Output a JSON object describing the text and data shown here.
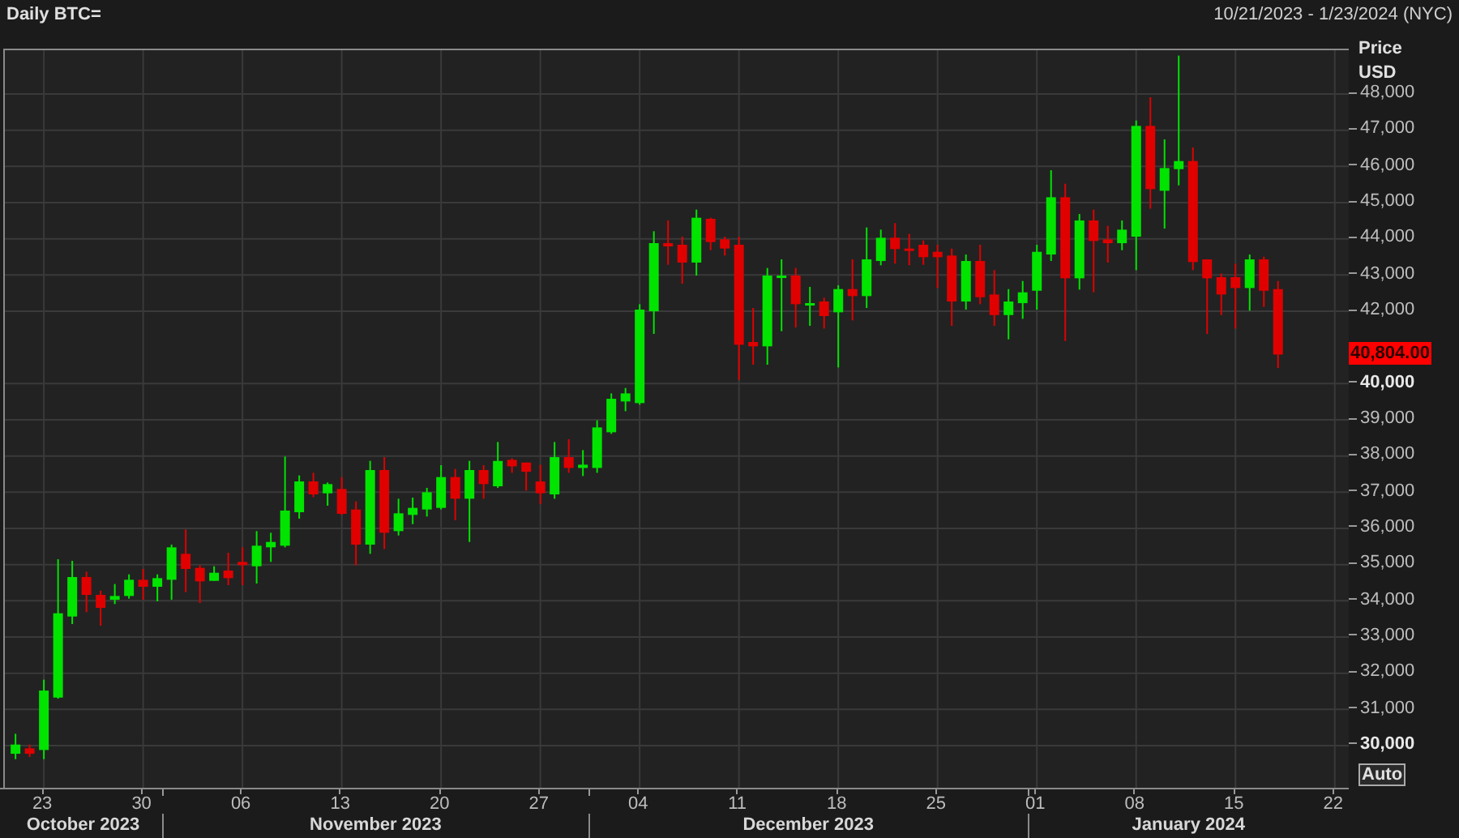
{
  "header": {
    "date_range": "10/21/2023 - 1/23/2024 (NYC)"
  },
  "price_axis": {
    "title": "Price",
    "unit": "USD",
    "last_price": "40,804.00",
    "auto_button": "Auto"
  },
  "x_axis": {
    "months": [
      {
        "label": "October 2023"
      },
      {
        "label": "November 2023"
      },
      {
        "label": "December 2023"
      },
      {
        "label": "January 2024"
      }
    ]
  },
  "chart": {
    "chart_data": {
      "type": "candlestick",
      "title": "Daily BTC=",
      "grid": true,
      "x": [
        "2023-10-21",
        "2023-10-22",
        "2023-10-23",
        "2023-10-24",
        "2023-10-25",
        "2023-10-26",
        "2023-10-27",
        "2023-10-28",
        "2023-10-29",
        "2023-10-30",
        "2023-10-31",
        "2023-11-01",
        "2023-11-02",
        "2023-11-03",
        "2023-11-04",
        "2023-11-05",
        "2023-11-06",
        "2023-11-07",
        "2023-11-08",
        "2023-11-09",
        "2023-11-10",
        "2023-11-11",
        "2023-11-12",
        "2023-11-13",
        "2023-11-14",
        "2023-11-15",
        "2023-11-16",
        "2023-11-17",
        "2023-11-18",
        "2023-11-19",
        "2023-11-20",
        "2023-11-21",
        "2023-11-22",
        "2023-11-23",
        "2023-11-24",
        "2023-11-25",
        "2023-11-26",
        "2023-11-27",
        "2023-11-28",
        "2023-11-29",
        "2023-11-30",
        "2023-12-01",
        "2023-12-02",
        "2023-12-03",
        "2023-12-04",
        "2023-12-05",
        "2023-12-06",
        "2023-12-07",
        "2023-12-08",
        "2023-12-09",
        "2023-12-10",
        "2023-12-11",
        "2023-12-12",
        "2023-12-13",
        "2023-12-14",
        "2023-12-15",
        "2023-12-16",
        "2023-12-17",
        "2023-12-18",
        "2023-12-19",
        "2023-12-20",
        "2023-12-21",
        "2023-12-22",
        "2023-12-23",
        "2023-12-24",
        "2023-12-25",
        "2023-12-26",
        "2023-12-27",
        "2023-12-28",
        "2023-12-29",
        "2023-12-30",
        "2023-12-31",
        "2024-01-01",
        "2024-01-02",
        "2024-01-03",
        "2024-01-04",
        "2024-01-05",
        "2024-01-06",
        "2024-01-07",
        "2024-01-08",
        "2024-01-09",
        "2024-01-10",
        "2024-01-11",
        "2024-01-12",
        "2024-01-13",
        "2024-01-14",
        "2024-01-15",
        "2024-01-16",
        "2024-01-17",
        "2024-01-18"
      ],
      "ohlc": [
        [
          29774,
          30326,
          29625,
          30028
        ],
        [
          29923,
          30028,
          29684,
          29774
        ],
        [
          29878,
          31820,
          29625,
          31520
        ],
        [
          31326,
          35148,
          31296,
          33655
        ],
        [
          33566,
          35104,
          33357,
          34656
        ],
        [
          34656,
          34805,
          33685,
          34163
        ],
        [
          34163,
          34282,
          33312,
          33805
        ],
        [
          34029,
          34462,
          33909,
          34133
        ],
        [
          34133,
          34730,
          34059,
          34581
        ],
        [
          34581,
          34880,
          34029,
          34387
        ],
        [
          34387,
          34730,
          33984,
          34626
        ],
        [
          34581,
          35552,
          34029,
          35477
        ],
        [
          35298,
          35970,
          34238,
          34880
        ],
        [
          34910,
          34984,
          33939,
          34536
        ],
        [
          34551,
          34954,
          34551,
          34775
        ],
        [
          34835,
          35328,
          34432,
          34626
        ],
        [
          35074,
          35477,
          34432,
          34984
        ],
        [
          34954,
          35925,
          34477,
          35522
        ],
        [
          35477,
          35880,
          35074,
          35626
        ],
        [
          35522,
          37985,
          35477,
          36492
        ],
        [
          36447,
          37463,
          36268,
          37298
        ],
        [
          37298,
          37537,
          36865,
          36940
        ],
        [
          36970,
          37269,
          36626,
          37224
        ],
        [
          37089,
          37418,
          36373,
          36402
        ],
        [
          36522,
          36746,
          34984,
          35552
        ],
        [
          35552,
          37866,
          35298,
          37612
        ],
        [
          37612,
          37970,
          35432,
          35880
        ],
        [
          35925,
          36820,
          35805,
          36417
        ],
        [
          36373,
          36850,
          36119,
          36567
        ],
        [
          36522,
          37119,
          36328,
          36999
        ],
        [
          36567,
          37746,
          36522,
          37418
        ],
        [
          37418,
          37642,
          36223,
          36820
        ],
        [
          36820,
          37866,
          35626,
          37612
        ],
        [
          37612,
          37746,
          36820,
          37224
        ],
        [
          37163,
          38387,
          37118,
          37864
        ],
        [
          37894,
          37939,
          37536,
          37715
        ],
        [
          37819,
          37819,
          37043,
          37566
        ],
        [
          37297,
          37760,
          36670,
          36969
        ],
        [
          36939,
          38387,
          36819,
          37969
        ],
        [
          37969,
          38462,
          37536,
          37670
        ],
        [
          37670,
          38163,
          37446,
          37760
        ],
        [
          37670,
          38984,
          37536,
          38790
        ],
        [
          38656,
          39730,
          38611,
          39581
        ],
        [
          39507,
          39880,
          39238,
          39730
        ],
        [
          39462,
          42194,
          39417,
          42045
        ],
        [
          41999,
          44210,
          41373,
          43881
        ],
        [
          43881,
          44508,
          43284,
          43791
        ],
        [
          43836,
          44060,
          42761,
          43344
        ],
        [
          43344,
          44807,
          42985,
          44583
        ],
        [
          44553,
          44583,
          43687,
          43911
        ],
        [
          43986,
          44060,
          43538,
          43732
        ],
        [
          43836,
          44060,
          40104,
          41074
        ],
        [
          41149,
          42089,
          40522,
          41030
        ],
        [
          41030,
          43194,
          40522,
          42985
        ],
        [
          42940,
          43433,
          41448,
          42985
        ],
        [
          42985,
          43194,
          41552,
          42194
        ],
        [
          42164,
          42672,
          41597,
          42224
        ],
        [
          42269,
          42373,
          41522,
          41866
        ],
        [
          41970,
          42717,
          40447,
          42612
        ],
        [
          42612,
          43433,
          41746,
          42418
        ],
        [
          42418,
          44314,
          42089,
          43433
        ],
        [
          43388,
          44254,
          43269,
          44030
        ],
        [
          44030,
          44433,
          43314,
          43717
        ],
        [
          43732,
          44135,
          43269,
          43687
        ],
        [
          43836,
          43956,
          43284,
          43493
        ],
        [
          43642,
          43836,
          42642,
          43493
        ],
        [
          43537,
          43731,
          41596,
          42268
        ],
        [
          42268,
          43567,
          42044,
          43388
        ],
        [
          43388,
          43835,
          42193,
          42387
        ],
        [
          42462,
          43134,
          41596,
          41894
        ],
        [
          41894,
          42611,
          41223,
          42268
        ],
        [
          42223,
          42835,
          41790,
          42522
        ],
        [
          42566,
          43835,
          42044,
          43641
        ],
        [
          43567,
          45896,
          43388,
          45149
        ],
        [
          45149,
          45522,
          41178,
          42910
        ],
        [
          42910,
          44686,
          42596,
          44507
        ],
        [
          44507,
          44806,
          42522,
          43940
        ],
        [
          43985,
          44358,
          43343,
          43880
        ],
        [
          43880,
          44507,
          43686,
          44253
        ],
        [
          44059,
          47269,
          43134,
          47120
        ],
        [
          47120,
          47911,
          44836,
          45373
        ],
        [
          45328,
          46747,
          44283,
          45955
        ],
        [
          45925,
          49061,
          45478,
          46149
        ],
        [
          46149,
          46523,
          43134,
          43358
        ],
        [
          43432,
          43432,
          41372,
          42910
        ],
        [
          42940,
          43044,
          41894,
          42462
        ],
        [
          42940,
          43313,
          41521,
          42641
        ],
        [
          42641,
          43567,
          42014,
          43432
        ],
        [
          43432,
          43507,
          42119,
          42566
        ],
        [
          42611,
          42835,
          40431,
          40804
        ]
      ],
      "xlim": [
        "2023-10-20T06:00:00",
        "2024-01-23T02:24:00"
      ],
      "ylim": [
        28790,
        49210
      ],
      "xticks": [
        {
          "value": "2023-10-23",
          "label": "23"
        },
        {
          "value": "2023-10-30",
          "label": "30"
        },
        {
          "value": "2023-11-06",
          "label": "06"
        },
        {
          "value": "2023-11-13",
          "label": "13"
        },
        {
          "value": "2023-11-20",
          "label": "20"
        },
        {
          "value": "2023-11-27",
          "label": "27"
        },
        {
          "value": "2023-12-04",
          "label": "04"
        },
        {
          "value": "2023-12-11",
          "label": "11"
        },
        {
          "value": "2023-12-18",
          "label": "18"
        },
        {
          "value": "2023-12-25",
          "label": "25"
        },
        {
          "value": "2024-01-01",
          "label": "01"
        },
        {
          "value": "2024-01-08",
          "label": "08"
        },
        {
          "value": "2024-01-15",
          "label": "15"
        },
        {
          "value": "2024-01-22",
          "label": "22"
        }
      ],
      "yticks": [
        {
          "value": 30000,
          "label": "30,000"
        },
        {
          "value": 31000,
          "label": "31,000"
        },
        {
          "value": 32000,
          "label": "32,000"
        },
        {
          "value": 33000,
          "label": "33,000"
        },
        {
          "value": 34000,
          "label": "34,000"
        },
        {
          "value": 35000,
          "label": "35,000"
        },
        {
          "value": 36000,
          "label": "36,000"
        },
        {
          "value": 37000,
          "label": "37,000"
        },
        {
          "value": 38000,
          "label": "38,000"
        },
        {
          "value": 39000,
          "label": "39,000"
        },
        {
          "value": 40000,
          "label": "40,000"
        },
        {
          "value": 42000,
          "label": "42,000"
        },
        {
          "value": 43000,
          "label": "43,000"
        },
        {
          "value": 44000,
          "label": "44,000"
        },
        {
          "value": 45000,
          "label": "45,000"
        },
        {
          "value": 46000,
          "label": "46,000"
        },
        {
          "value": 47000,
          "label": "47,000"
        },
        {
          "value": 48000,
          "label": "48,000"
        }
      ]
    }
  }
}
